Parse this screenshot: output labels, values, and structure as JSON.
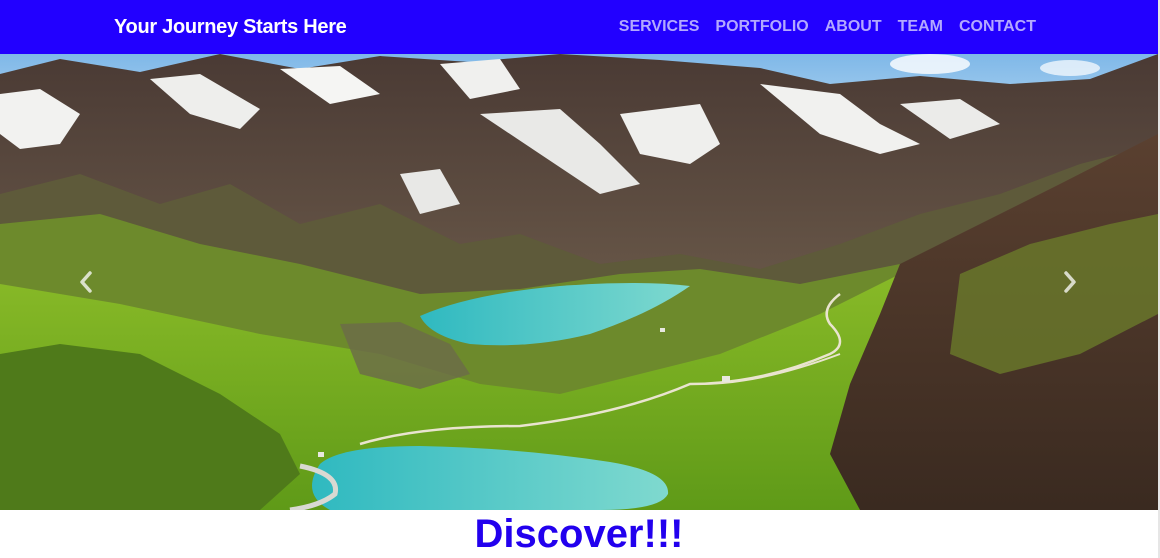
{
  "navbar": {
    "brand": "Your Journey Starts Here",
    "links": [
      "SERVICES",
      "PORTFOLIO",
      "ABOUT",
      "TEAM",
      "CONTACT"
    ]
  },
  "carousel": {
    "image_subject": "mountain-valley-lakes",
    "prev_icon": "chevron-left-icon",
    "next_icon": "chevron-right-icon"
  },
  "hero": {
    "heading": "Discover!!!"
  },
  "colors": {
    "navbar_bg": "#2200ff",
    "brand_text": "#ffffff",
    "nav_link_text": "#b3a8ff",
    "heading_text": "#2200ee"
  }
}
